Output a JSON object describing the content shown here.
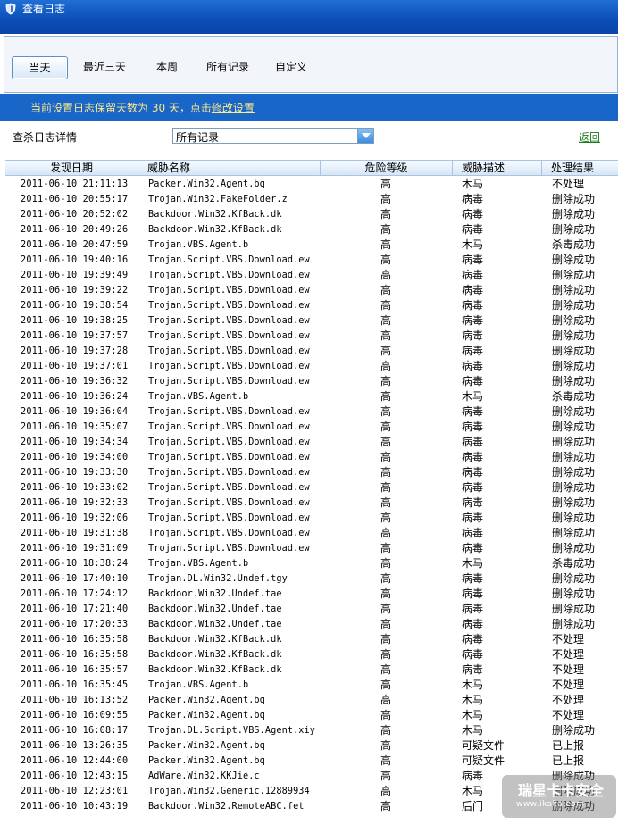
{
  "window": {
    "title": "查看日志",
    "icon": "shield-app-icon"
  },
  "tabs": [
    {
      "label": "当天",
      "active": true
    },
    {
      "label": "最近三天",
      "active": false
    },
    {
      "label": "本周",
      "active": false
    },
    {
      "label": "所有记录",
      "active": false
    },
    {
      "label": "自定义",
      "active": false
    }
  ],
  "notice": {
    "text": "当前设置日志保留天数为 30 天，点击",
    "link": "修改设置"
  },
  "filter": {
    "label": "查杀日志详情",
    "selected": "所有记录",
    "back_label": "返回"
  },
  "table": {
    "headers": [
      "发现日期",
      "威胁名称",
      "危险等级",
      "威胁描述",
      "处理结果"
    ],
    "rows": [
      [
        "2011-06-10 21:11:13",
        "Packer.Win32.Agent.bq",
        "高",
        "木马",
        "不处理"
      ],
      [
        "2011-06-10 20:55:17",
        "Trojan.Win32.FakeFolder.z",
        "高",
        "病毒",
        "删除成功"
      ],
      [
        "2011-06-10 20:52:02",
        "Backdoor.Win32.KfBack.dk",
        "高",
        "病毒",
        "删除成功"
      ],
      [
        "2011-06-10 20:49:26",
        "Backdoor.Win32.KfBack.dk",
        "高",
        "病毒",
        "删除成功"
      ],
      [
        "2011-06-10 20:47:59",
        "Trojan.VBS.Agent.b",
        "高",
        "木马",
        "杀毒成功"
      ],
      [
        "2011-06-10 19:40:16",
        "Trojan.Script.VBS.Download.ew",
        "高",
        "病毒",
        "删除成功"
      ],
      [
        "2011-06-10 19:39:49",
        "Trojan.Script.VBS.Download.ew",
        "高",
        "病毒",
        "删除成功"
      ],
      [
        "2011-06-10 19:39:22",
        "Trojan.Script.VBS.Download.ew",
        "高",
        "病毒",
        "删除成功"
      ],
      [
        "2011-06-10 19:38:54",
        "Trojan.Script.VBS.Download.ew",
        "高",
        "病毒",
        "删除成功"
      ],
      [
        "2011-06-10 19:38:25",
        "Trojan.Script.VBS.Download.ew",
        "高",
        "病毒",
        "删除成功"
      ],
      [
        "2011-06-10 19:37:57",
        "Trojan.Script.VBS.Download.ew",
        "高",
        "病毒",
        "删除成功"
      ],
      [
        "2011-06-10 19:37:28",
        "Trojan.Script.VBS.Download.ew",
        "高",
        "病毒",
        "删除成功"
      ],
      [
        "2011-06-10 19:37:01",
        "Trojan.Script.VBS.Download.ew",
        "高",
        "病毒",
        "删除成功"
      ],
      [
        "2011-06-10 19:36:32",
        "Trojan.Script.VBS.Download.ew",
        "高",
        "病毒",
        "删除成功"
      ],
      [
        "2011-06-10 19:36:24",
        "Trojan.VBS.Agent.b",
        "高",
        "木马",
        "杀毒成功"
      ],
      [
        "2011-06-10 19:36:04",
        "Trojan.Script.VBS.Download.ew",
        "高",
        "病毒",
        "删除成功"
      ],
      [
        "2011-06-10 19:35:07",
        "Trojan.Script.VBS.Download.ew",
        "高",
        "病毒",
        "删除成功"
      ],
      [
        "2011-06-10 19:34:34",
        "Trojan.Script.VBS.Download.ew",
        "高",
        "病毒",
        "删除成功"
      ],
      [
        "2011-06-10 19:34:00",
        "Trojan.Script.VBS.Download.ew",
        "高",
        "病毒",
        "删除成功"
      ],
      [
        "2011-06-10 19:33:30",
        "Trojan.Script.VBS.Download.ew",
        "高",
        "病毒",
        "删除成功"
      ],
      [
        "2011-06-10 19:33:02",
        "Trojan.Script.VBS.Download.ew",
        "高",
        "病毒",
        "删除成功"
      ],
      [
        "2011-06-10 19:32:33",
        "Trojan.Script.VBS.Download.ew",
        "高",
        "病毒",
        "删除成功"
      ],
      [
        "2011-06-10 19:32:06",
        "Trojan.Script.VBS.Download.ew",
        "高",
        "病毒",
        "删除成功"
      ],
      [
        "2011-06-10 19:31:38",
        "Trojan.Script.VBS.Download.ew",
        "高",
        "病毒",
        "删除成功"
      ],
      [
        "2011-06-10 19:31:09",
        "Trojan.Script.VBS.Download.ew",
        "高",
        "病毒",
        "删除成功"
      ],
      [
        "2011-06-10 18:38:24",
        "Trojan.VBS.Agent.b",
        "高",
        "木马",
        "杀毒成功"
      ],
      [
        "2011-06-10 17:40:10",
        "Trojan.DL.Win32.Undef.tgy",
        "高",
        "病毒",
        "删除成功"
      ],
      [
        "2011-06-10 17:24:12",
        "Backdoor.Win32.Undef.tae",
        "高",
        "病毒",
        "删除成功"
      ],
      [
        "2011-06-10 17:21:40",
        "Backdoor.Win32.Undef.tae",
        "高",
        "病毒",
        "删除成功"
      ],
      [
        "2011-06-10 17:20:33",
        "Backdoor.Win32.Undef.tae",
        "高",
        "病毒",
        "删除成功"
      ],
      [
        "2011-06-10 16:35:58",
        "Backdoor.Win32.KfBack.dk",
        "高",
        "病毒",
        "不处理"
      ],
      [
        "2011-06-10 16:35:58",
        "Backdoor.Win32.KfBack.dk",
        "高",
        "病毒",
        "不处理"
      ],
      [
        "2011-06-10 16:35:57",
        "Backdoor.Win32.KfBack.dk",
        "高",
        "病毒",
        "不处理"
      ],
      [
        "2011-06-10 16:35:45",
        "Trojan.VBS.Agent.b",
        "高",
        "木马",
        "不处理"
      ],
      [
        "2011-06-10 16:13:52",
        "Packer.Win32.Agent.bq",
        "高",
        "木马",
        "不处理"
      ],
      [
        "2011-06-10 16:09:55",
        "Packer.Win32.Agent.bq",
        "高",
        "木马",
        "不处理"
      ],
      [
        "2011-06-10 16:08:17",
        "Trojan.DL.Script.VBS.Agent.xiy",
        "高",
        "木马",
        "删除成功"
      ],
      [
        "2011-06-10 13:26:35",
        "Packer.Win32.Agent.bq",
        "高",
        "可疑文件",
        "已上报"
      ],
      [
        "2011-06-10 12:44:00",
        "Packer.Win32.Agent.bq",
        "高",
        "可疑文件",
        "已上报"
      ],
      [
        "2011-06-10 12:43:15",
        "AdWare.Win32.KKJie.c",
        "高",
        "病毒",
        "删除成功"
      ],
      [
        "2011-06-10 12:23:01",
        "Trojan.Win32.Generic.12889934",
        "高",
        "木马",
        "删除成功"
      ],
      [
        "2011-06-10 10:43:19",
        "Backdoor.Win32.RemoteABC.fet",
        "高",
        "后门",
        "删除成功"
      ]
    ]
  },
  "watermark": {
    "line1": "瑞星卡卡安全",
    "line2": "www.ikaka.com"
  }
}
